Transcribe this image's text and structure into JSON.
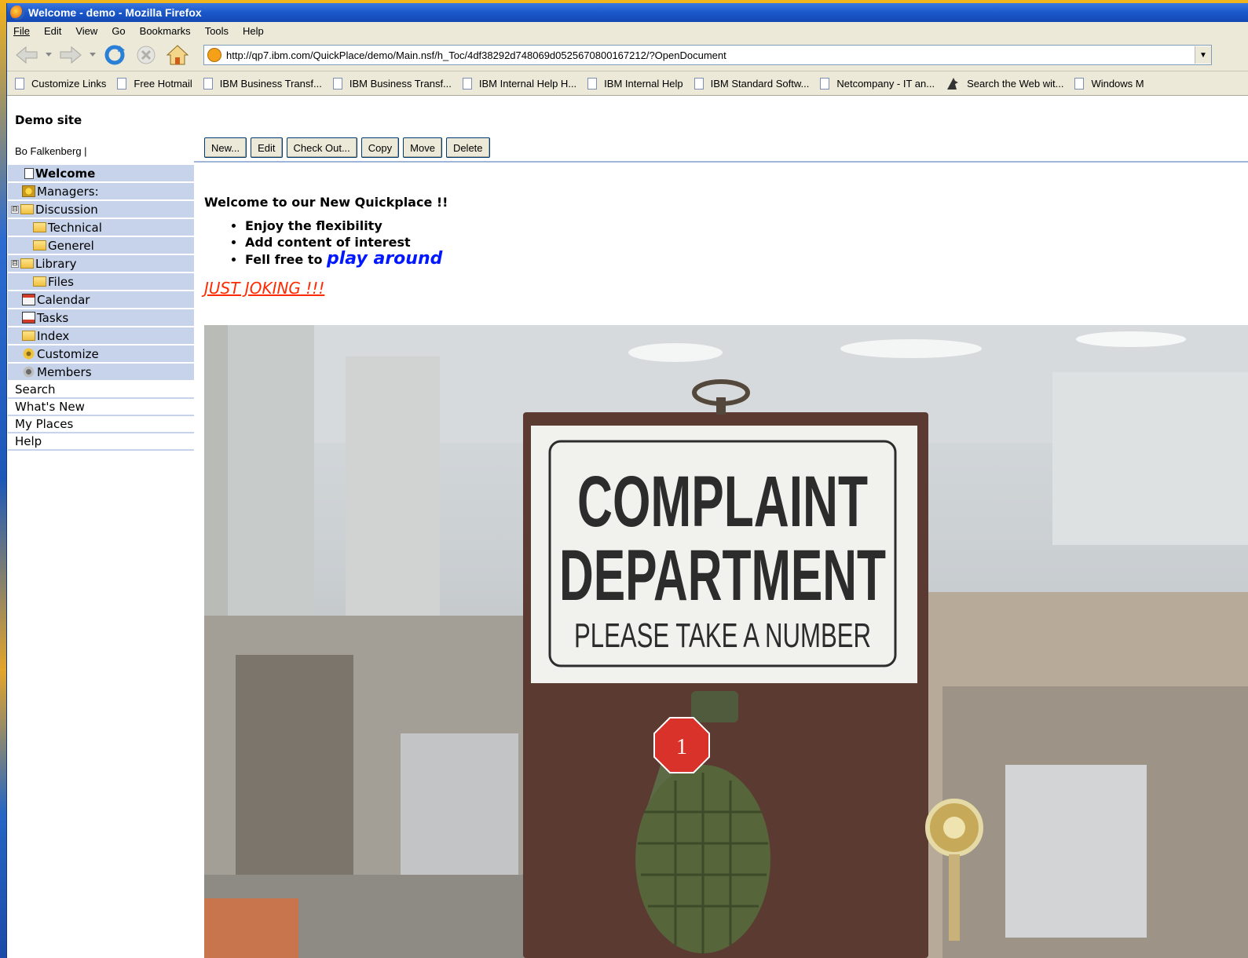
{
  "window": {
    "title": "Welcome - demo - Mozilla Firefox"
  },
  "menu": [
    "File",
    "Edit",
    "View",
    "Go",
    "Bookmarks",
    "Tools",
    "Help"
  ],
  "navbar": {
    "url": "http://qp7.ibm.com/QuickPlace/demo/Main.nsf/h_Toc/4df38292d748069d0525670800167212/?OpenDocument"
  },
  "bookmarks": [
    "Customize Links",
    "Free Hotmail",
    "IBM Business Transf...",
    "IBM Business Transf...",
    "IBM Internal Help H...",
    "IBM Internal Help",
    "IBM Standard Softw...",
    "Netcompany - IT an...",
    "Search the Web wit...",
    "Windows M"
  ],
  "site": {
    "title": "Demo site",
    "user": "Bo Falkenberg  |"
  },
  "actions": [
    "New...",
    "Edit",
    "Check Out...",
    "Copy",
    "Move",
    "Delete"
  ],
  "toc": [
    {
      "label": "Welcome",
      "icon": "page-icon",
      "indent": 0,
      "expander": "",
      "selected": true
    },
    {
      "label": "Managers:",
      "icon": "managers-icon",
      "indent": 0,
      "expander": ""
    },
    {
      "label": "Discussion",
      "icon": "open-folder-icon",
      "indent": 0,
      "expander": "⊟"
    },
    {
      "label": "Technical",
      "icon": "folder-icon",
      "indent": 1,
      "expander": ""
    },
    {
      "label": "Generel",
      "icon": "folder-icon",
      "indent": 1,
      "expander": ""
    },
    {
      "label": "Library",
      "icon": "open-folder-icon",
      "indent": 0,
      "expander": "⊟"
    },
    {
      "label": "Files",
      "icon": "folder-icon",
      "indent": 1,
      "expander": ""
    },
    {
      "label": "Calendar",
      "icon": "calendar-icon",
      "indent": 0,
      "expander": ""
    },
    {
      "label": "Tasks",
      "icon": "tasks-icon",
      "indent": 0,
      "expander": ""
    },
    {
      "label": "Index",
      "icon": "folder-icon",
      "indent": 0,
      "expander": ""
    },
    {
      "label": "Customize",
      "icon": "customize-icon",
      "indent": 0,
      "expander": ""
    },
    {
      "label": "Members",
      "icon": "members-icon",
      "indent": 0,
      "expander": ""
    }
  ],
  "links": [
    "Search",
    "What's New",
    "My Places",
    "Help"
  ],
  "content": {
    "heading": "Welcome to our New Quickplace !!",
    "bullets": [
      "Enjoy the flexibility",
      "Add content of interest"
    ],
    "bullet3_prefix": "Fell free to",
    "bullet3_link": "play around",
    "joking": "JUST JOKING !!!",
    "sign": {
      "line1": "COMPLAINT",
      "line2": "DEPARTMENT",
      "line3": "PLEASE TAKE A NUMBER",
      "tag_number": "1"
    }
  },
  "colors": {
    "titlebar": "#1a57c9",
    "chrome": "#ece9d8",
    "toc_bg": "#c6d3ea",
    "link_blue": "#0018ff",
    "joking_red": "#ff2a00"
  }
}
